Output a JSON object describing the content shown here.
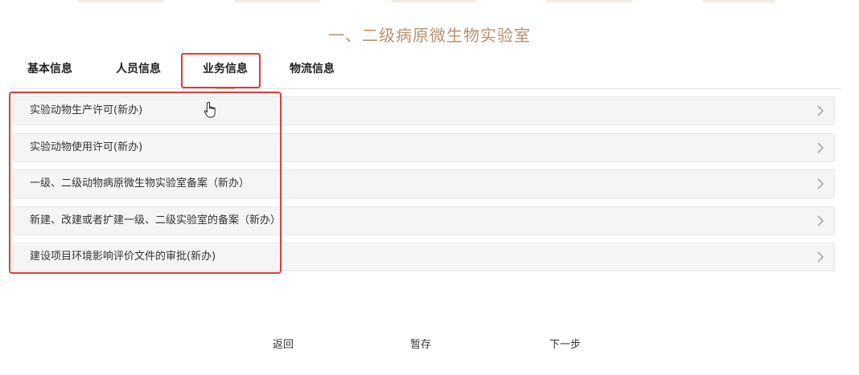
{
  "page": {
    "title": "一、二级病原微生物实验室"
  },
  "tabs": [
    {
      "label": "基本信息",
      "active": false
    },
    {
      "label": "人员信息",
      "active": false
    },
    {
      "label": "业务信息",
      "active": true
    },
    {
      "label": "物流信息",
      "active": false
    }
  ],
  "items": [
    {
      "label": "实验动物生产许可(新办)"
    },
    {
      "label": "实验动物使用许可(新办)"
    },
    {
      "label": "一级、二级动物病原微生物实验室备案（新办）"
    },
    {
      "label": "新建、改建或者扩建一级、二级实验室的备案（新办）"
    },
    {
      "label": "建设项目环境影响评价文件的审批(新办)"
    }
  ],
  "footer": {
    "back_label": "返回",
    "save_label": "暂存",
    "next_label": "下一步"
  },
  "icons": {
    "row_arrow": "chevron-right-icon",
    "cursor": "hand-pointer-icon"
  },
  "colors": {
    "title": "#b8906e",
    "highlight": "#e23b3b",
    "row_bg": "#f5f5f5"
  }
}
